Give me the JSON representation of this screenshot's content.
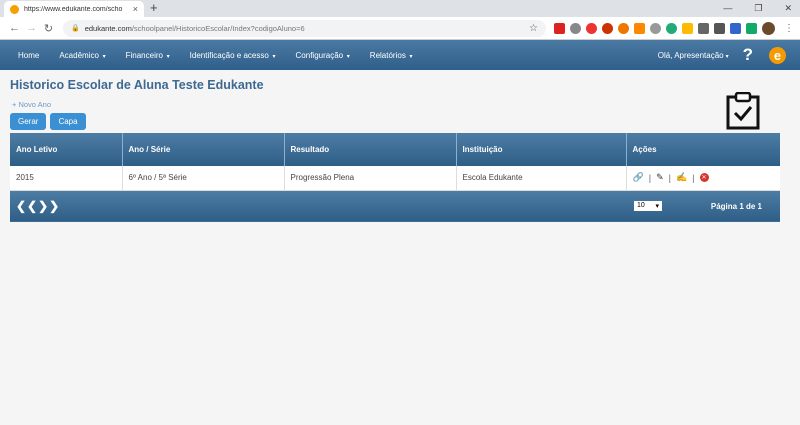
{
  "browser": {
    "tab_title": "https://www.edukante.com/scho",
    "tab_close": "×",
    "new_tab": "+",
    "url_host": "edukante.com",
    "url_path": "/schoolpanel/HistoricoEscolar/Index?codigoAluno=6"
  },
  "nav": {
    "items": [
      "Home",
      "Acadêmico",
      "Financeiro",
      "Identificação e acesso",
      "Configuração",
      "Relatórios"
    ],
    "greeting": "Olá, Apresentação",
    "help": "?",
    "logo": "e"
  },
  "page": {
    "title": "Historico Escolar de Aluna Teste Edukante",
    "new_year": "+ Novo Ano",
    "btn_gerar": "Gerar",
    "btn_capa": "Capa"
  },
  "table": {
    "headers": [
      "Ano Letivo",
      "Ano / Série",
      "Resultado",
      "Instituição",
      "Ações"
    ],
    "rows": [
      [
        "2015",
        "6º Ano / 5ª Série",
        "Progressão Plena",
        "Escola Edukante"
      ]
    ],
    "page_size": "10",
    "page_info": "Página 1 de 1",
    "pager_arrows": "❮❮❯❯"
  },
  "icons": [
    "link-icon",
    "edit-icon",
    "edit-alt-icon",
    "delete-icon",
    "clipboard-check-icon"
  ],
  "colors": {
    "nav_bg": "#2f5f8a",
    "title": "#3d6a92",
    "button": "#3b8fd3",
    "logo": "#f59a00",
    "delete": "#d9342b"
  }
}
